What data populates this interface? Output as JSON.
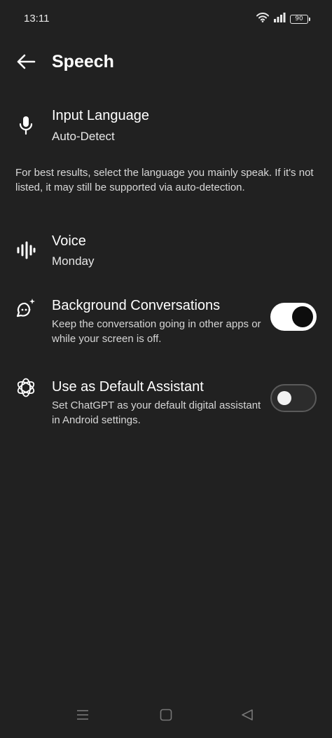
{
  "status_bar": {
    "time": "13:11",
    "battery": "90"
  },
  "header": {
    "title": "Speech",
    "back_icon": "arrow-left-icon"
  },
  "settings": {
    "input_language": {
      "icon": "microphone-icon",
      "title": "Input Language",
      "value": "Auto-Detect"
    },
    "hint": "For best results, select the language you mainly speak. If it's not listed, it may still be supported via auto-detection.",
    "voice": {
      "icon": "waveform-icon",
      "title": "Voice",
      "value": "Monday"
    },
    "background_conversations": {
      "icon": "chat-bubble-sparkle-icon",
      "title": "Background Conversations",
      "description": "Keep the conversation going in other apps or while your screen is off.",
      "enabled": true
    },
    "default_assistant": {
      "icon": "chatgpt-logo-icon",
      "title": "Use as Default Assistant",
      "description": "Set ChatGPT as your default digital assistant in Android settings.",
      "enabled": false
    }
  },
  "nav_bar": {
    "buttons": [
      "menu-icon",
      "home-icon",
      "back-triangle-icon"
    ]
  },
  "colors": {
    "background": "#212121",
    "text": "#ffffff",
    "toggle_on": "#ffffff",
    "toggle_off_track": "#2c2c2c"
  }
}
